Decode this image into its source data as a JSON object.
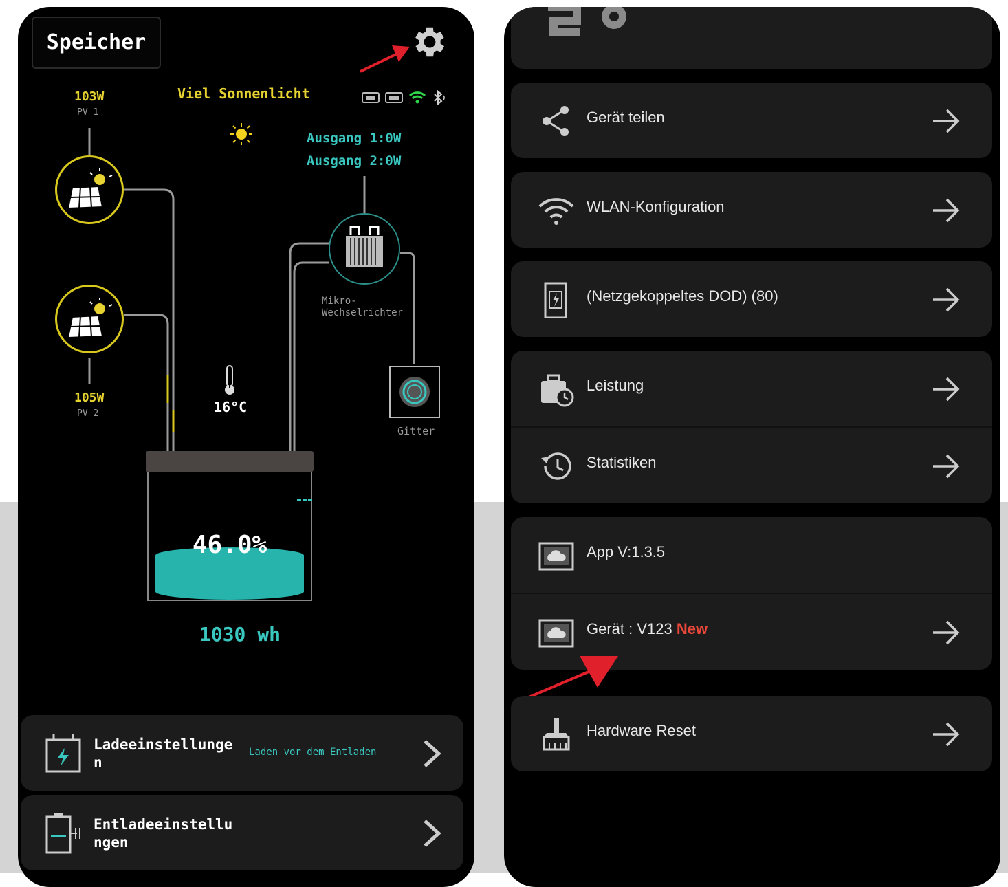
{
  "left": {
    "title": "Speicher",
    "weather": "Viel Sonnenlicht",
    "pv1": {
      "power": "103W",
      "label": "PV 1"
    },
    "pv2": {
      "power": "105W",
      "label": "PV 2"
    },
    "outputs": [
      "Ausgang 1:0W",
      "Ausgang 2:0W"
    ],
    "inverter_label_1": "Mikro-",
    "inverter_label_2": "Wechselrichter",
    "grid_label": "Gitter",
    "temperature": "16°C",
    "battery_percent_text": "46.0%",
    "battery_level": 0.46,
    "capacity": "1030 wh",
    "charge": {
      "label_1": "Ladeeinstellunge",
      "label_2": "n",
      "sub": "Laden vor dem Entladen"
    },
    "discharge": {
      "label_1": "Entladeeinstellu",
      "label_2": "ngen"
    }
  },
  "right": {
    "items": [
      {
        "label": "Gerät teilen",
        "icon": "share-icon"
      },
      {
        "label": "WLAN-Konfiguration",
        "icon": "wifi-icon"
      },
      {
        "label": "(Netzgekoppeltes DOD) (80)",
        "icon": "battery-bolt-icon"
      },
      {
        "label": "Leistung",
        "icon": "briefcase-clock-icon"
      },
      {
        "label": "Statistiken",
        "icon": "history-icon"
      },
      {
        "label": "App V:1.3.5",
        "icon": "cloud-window-icon"
      },
      {
        "label": "Gerät : V123",
        "badge": "New",
        "icon": "cloud-window-icon"
      },
      {
        "label": "Hardware Reset",
        "icon": "broom-icon"
      }
    ]
  },
  "colors": {
    "accent_teal": "#39c7c0",
    "pv_yellow": "#e6d230",
    "annotation_red": "#e0202a",
    "new_badge": "#e8473a"
  }
}
